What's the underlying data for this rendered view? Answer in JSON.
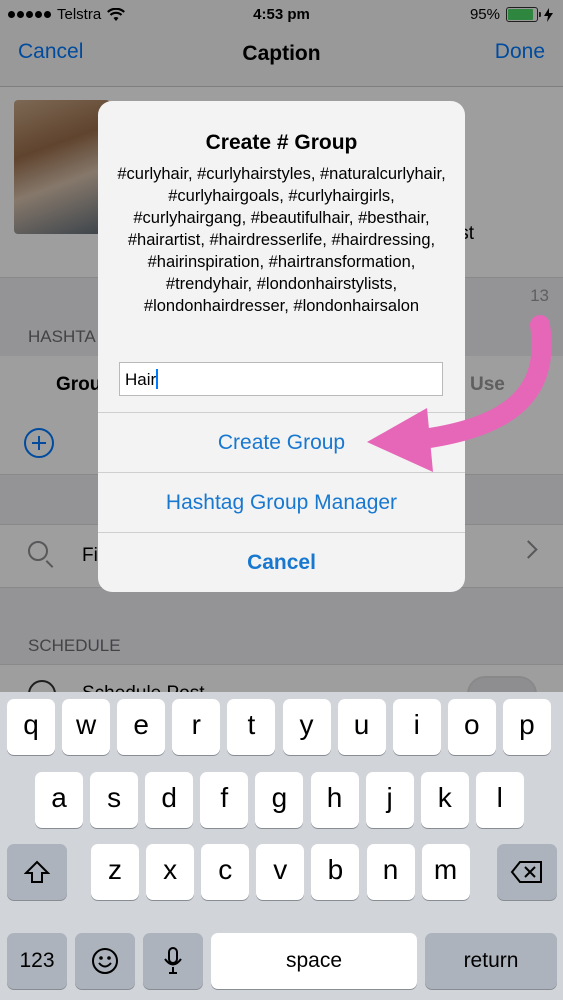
{
  "status_bar": {
    "carrier": "Telstra",
    "time": "4:53 pm",
    "battery_percent": "95%",
    "battery_level": 0.95
  },
  "nav": {
    "cancel_label": "Cancel",
    "title": "Caption",
    "done_label": "Done"
  },
  "background": {
    "char_count": "13",
    "hashtags_header": "HASHTA",
    "groups_label": "Grou",
    "used_label": "Use",
    "find_label": "Fi",
    "schedule_header": "SCHEDULE",
    "schedule_post_label": "Schedule Post",
    "caption_partial_line1": "s",
    "caption_partial_line2": "ist"
  },
  "alert": {
    "title": "Create # Group",
    "message": "#curlyhair, #curlyhairstyles, #naturalcurlyhair, #curlyhairgoals, #curlyhairgirls, #curlyhairgang, #beautifulhair, #besthair, #hairartist, #hairdresserlife, #hairdressing, #hairinspiration, #hairtransformation, #trendyhair, #londonhairstylists, #londonhairdresser, #londonhairsalon",
    "input_value": "Hair",
    "buttons": {
      "create_group": "Create Group",
      "manager": "Hashtag Group Manager",
      "cancel": "Cancel"
    }
  },
  "keyboard": {
    "row1": [
      "q",
      "w",
      "e",
      "r",
      "t",
      "y",
      "u",
      "i",
      "o",
      "p"
    ],
    "row2": [
      "a",
      "s",
      "d",
      "f",
      "g",
      "h",
      "j",
      "k",
      "l"
    ],
    "row3": [
      "z",
      "x",
      "c",
      "v",
      "b",
      "n",
      "m"
    ],
    "numbers_key": "123",
    "space_key": "space",
    "return_key": "return"
  },
  "colors": {
    "accent": "#007aff",
    "alert_button": "#1878d0",
    "arrow": "#e667b8"
  }
}
